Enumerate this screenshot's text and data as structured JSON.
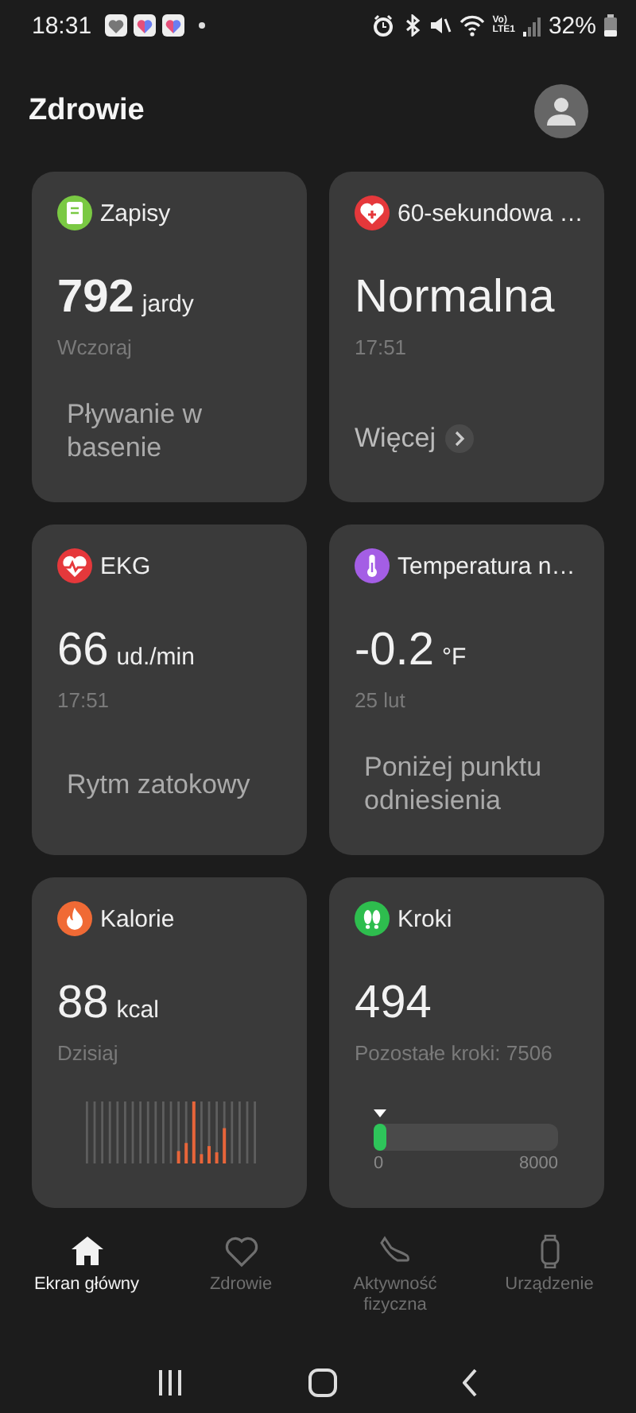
{
  "status_bar": {
    "time": "18:31",
    "network": [
      "Vo)",
      "LTE1"
    ],
    "battery": "32%"
  },
  "header": {
    "title": "Zdrowie"
  },
  "cards": [
    {
      "kind": "record",
      "title": "Zapisy",
      "color": "#7ac943",
      "value": "792",
      "unit": "jardy",
      "sub": "Wczoraj",
      "description": "Pływanie w basenie"
    },
    {
      "kind": "more",
      "title": "60-sekundowa …",
      "color": "#e5383b",
      "value": "Normalna",
      "sub": "17:51",
      "link": "Więcej"
    },
    {
      "kind": "reading",
      "title": "EKG",
      "color": "#e5383b",
      "value": "66",
      "unit": "ud./min",
      "sub": "17:51",
      "description": "Rytm zatokowy"
    },
    {
      "kind": "reading",
      "title": "Temperatura n…",
      "color": "#a45ee5",
      "value": "-0.2",
      "unit": "°F",
      "sub": "25 lut",
      "description": "Poniżej punktu odniesienia"
    },
    {
      "kind": "calories",
      "title": "Kalorie",
      "color": "#f06a35",
      "value": "88",
      "unit": "kcal",
      "sub": "Dzisiaj"
    },
    {
      "kind": "steps",
      "title": "Kroki",
      "color": "#2ebd4e",
      "value": "494",
      "sub": "Pozostałe kroki: 7506",
      "level": 0.06,
      "min": "0",
      "max": "8000"
    }
  ],
  "nav": [
    {
      "label": "Ekran główny",
      "selected": true
    },
    {
      "label": "Zdrowie",
      "selected": false
    },
    {
      "label": "Aktywność fizyczna",
      "selected": false
    },
    {
      "label": "Urządzenie",
      "selected": false
    }
  ]
}
